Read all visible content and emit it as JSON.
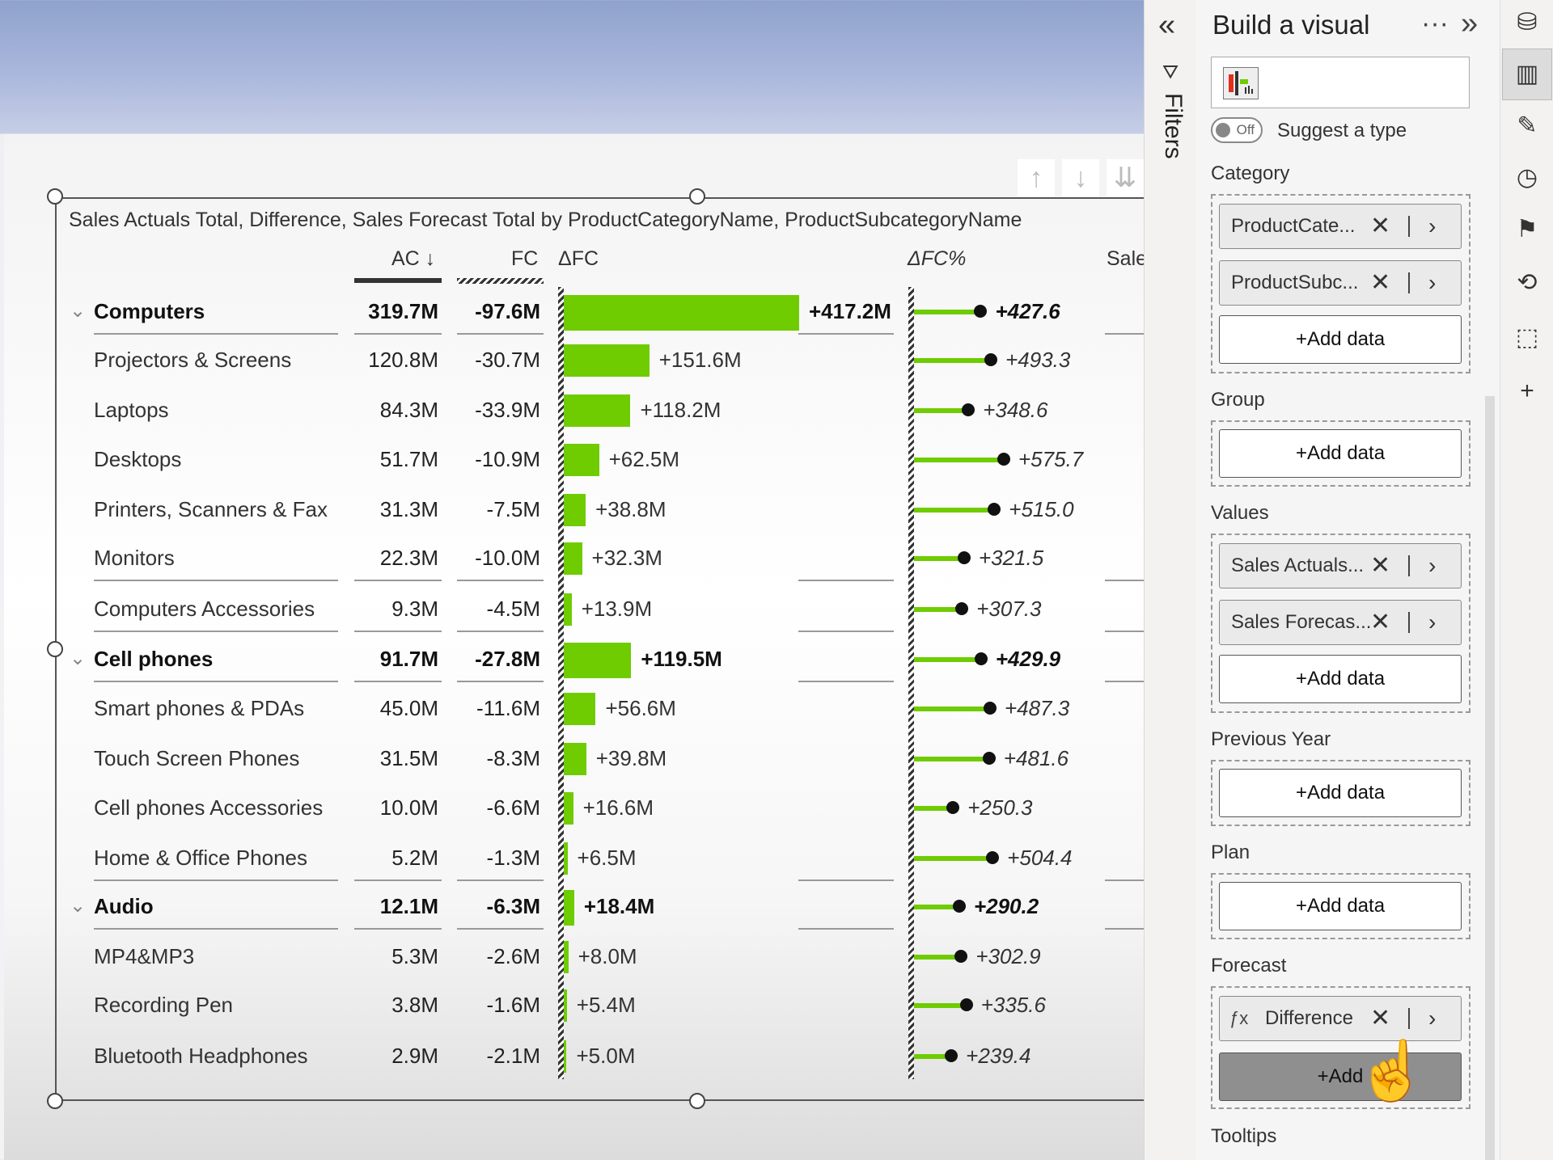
{
  "visual": {
    "title": "Sales Actuals Total, Difference, Sales Forecast Total by ProductCategoryName, ProductSubcategoryName",
    "columns": {
      "ac": "AC ↓",
      "fc": "FC",
      "dfc": "ΔFC",
      "dfc_pct": "ΔFC%",
      "truncated": "Sale"
    },
    "rows": [
      {
        "name": "Computers",
        "ac": "319.7M",
        "fc": "-97.6M",
        "dfc": "+417.2M",
        "dfc_pct": "+427.6",
        "group": true,
        "dfc_val": 417.2,
        "pct_val": 427.6
      },
      {
        "name": "Projectors & Screens",
        "ac": "120.8M",
        "fc": "-30.7M",
        "dfc": "+151.6M",
        "dfc_pct": "+493.3",
        "group": false,
        "dfc_val": 151.6,
        "pct_val": 493.3
      },
      {
        "name": "Laptops",
        "ac": "84.3M",
        "fc": "-33.9M",
        "dfc": "+118.2M",
        "dfc_pct": "+348.6",
        "group": false,
        "dfc_val": 118.2,
        "pct_val": 348.6
      },
      {
        "name": "Desktops",
        "ac": "51.7M",
        "fc": "-10.9M",
        "dfc": "+62.5M",
        "dfc_pct": "+575.7",
        "group": false,
        "dfc_val": 62.5,
        "pct_val": 575.7
      },
      {
        "name": "Printers, Scanners & Fax",
        "ac": "31.3M",
        "fc": "-7.5M",
        "dfc": "+38.8M",
        "dfc_pct": "+515.0",
        "group": false,
        "dfc_val": 38.8,
        "pct_val": 515.0
      },
      {
        "name": "Monitors",
        "ac": "22.3M",
        "fc": "-10.0M",
        "dfc": "+32.3M",
        "dfc_pct": "+321.5",
        "group": false,
        "dfc_val": 32.3,
        "pct_val": 321.5
      },
      {
        "name": "Computers Accessories",
        "ac": "9.3M",
        "fc": "-4.5M",
        "dfc": "+13.9M",
        "dfc_pct": "+307.3",
        "group": false,
        "dfc_val": 13.9,
        "pct_val": 307.3
      },
      {
        "name": "Cell phones",
        "ac": "91.7M",
        "fc": "-27.8M",
        "dfc": "+119.5M",
        "dfc_pct": "+429.9",
        "group": true,
        "dfc_val": 119.5,
        "pct_val": 429.9
      },
      {
        "name": "Smart phones & PDAs",
        "ac": "45.0M",
        "fc": "-11.6M",
        "dfc": "+56.6M",
        "dfc_pct": "+487.3",
        "group": false,
        "dfc_val": 56.6,
        "pct_val": 487.3
      },
      {
        "name": "Touch Screen Phones",
        "ac": "31.5M",
        "fc": "-8.3M",
        "dfc": "+39.8M",
        "dfc_pct": "+481.6",
        "group": false,
        "dfc_val": 39.8,
        "pct_val": 481.6
      },
      {
        "name": "Cell phones Accessories",
        "ac": "10.0M",
        "fc": "-6.6M",
        "dfc": "+16.6M",
        "dfc_pct": "+250.3",
        "group": false,
        "dfc_val": 16.6,
        "pct_val": 250.3
      },
      {
        "name": "Home & Office Phones",
        "ac": "5.2M",
        "fc": "-1.3M",
        "dfc": "+6.5M",
        "dfc_pct": "+504.4",
        "group": false,
        "dfc_val": 6.5,
        "pct_val": 504.4
      },
      {
        "name": "Audio",
        "ac": "12.1M",
        "fc": "-6.3M",
        "dfc": "+18.4M",
        "dfc_pct": "+290.2",
        "group": true,
        "dfc_val": 18.4,
        "pct_val": 290.2
      },
      {
        "name": "MP4&MP3",
        "ac": "5.3M",
        "fc": "-2.6M",
        "dfc": "+8.0M",
        "dfc_pct": "+302.9",
        "group": false,
        "dfc_val": 8.0,
        "pct_val": 302.9
      },
      {
        "name": "Recording Pen",
        "ac": "3.8M",
        "fc": "-1.6M",
        "dfc": "+5.4M",
        "dfc_pct": "+335.6",
        "group": false,
        "dfc_val": 5.4,
        "pct_val": 335.6
      },
      {
        "name": "Bluetooth Headphones",
        "ac": "2.9M",
        "fc": "-2.1M",
        "dfc": "+5.0M",
        "dfc_pct": "+239.4",
        "group": false,
        "dfc_val": 5.0,
        "pct_val": 239.4
      }
    ]
  },
  "filters": {
    "label": "Filters"
  },
  "build_pane": {
    "title": "Build a visual",
    "more": "···",
    "suggest_toggle": "Off",
    "suggest_label": "Suggest a type",
    "sections": {
      "category": {
        "label": "Category",
        "chips": [
          "ProductCate...",
          "ProductSubc..."
        ],
        "add": "+Add data"
      },
      "group": {
        "label": "Group",
        "add": "+Add data"
      },
      "values": {
        "label": "Values",
        "chips": [
          "Sales Actuals...",
          "Sales Forecas..."
        ],
        "add": "+Add data"
      },
      "previous_year": {
        "label": "Previous Year",
        "add": "+Add data"
      },
      "plan": {
        "label": "Plan",
        "add": "+Add data"
      },
      "forecast": {
        "label": "Forecast",
        "chips": [
          "Difference"
        ],
        "add": "+Add"
      },
      "tooltips": {
        "label": "Tooltips"
      }
    }
  },
  "colors": {
    "bar_green": "#6ecc00",
    "dot": "#111111",
    "accent_hover": "#8f8f8f"
  }
}
